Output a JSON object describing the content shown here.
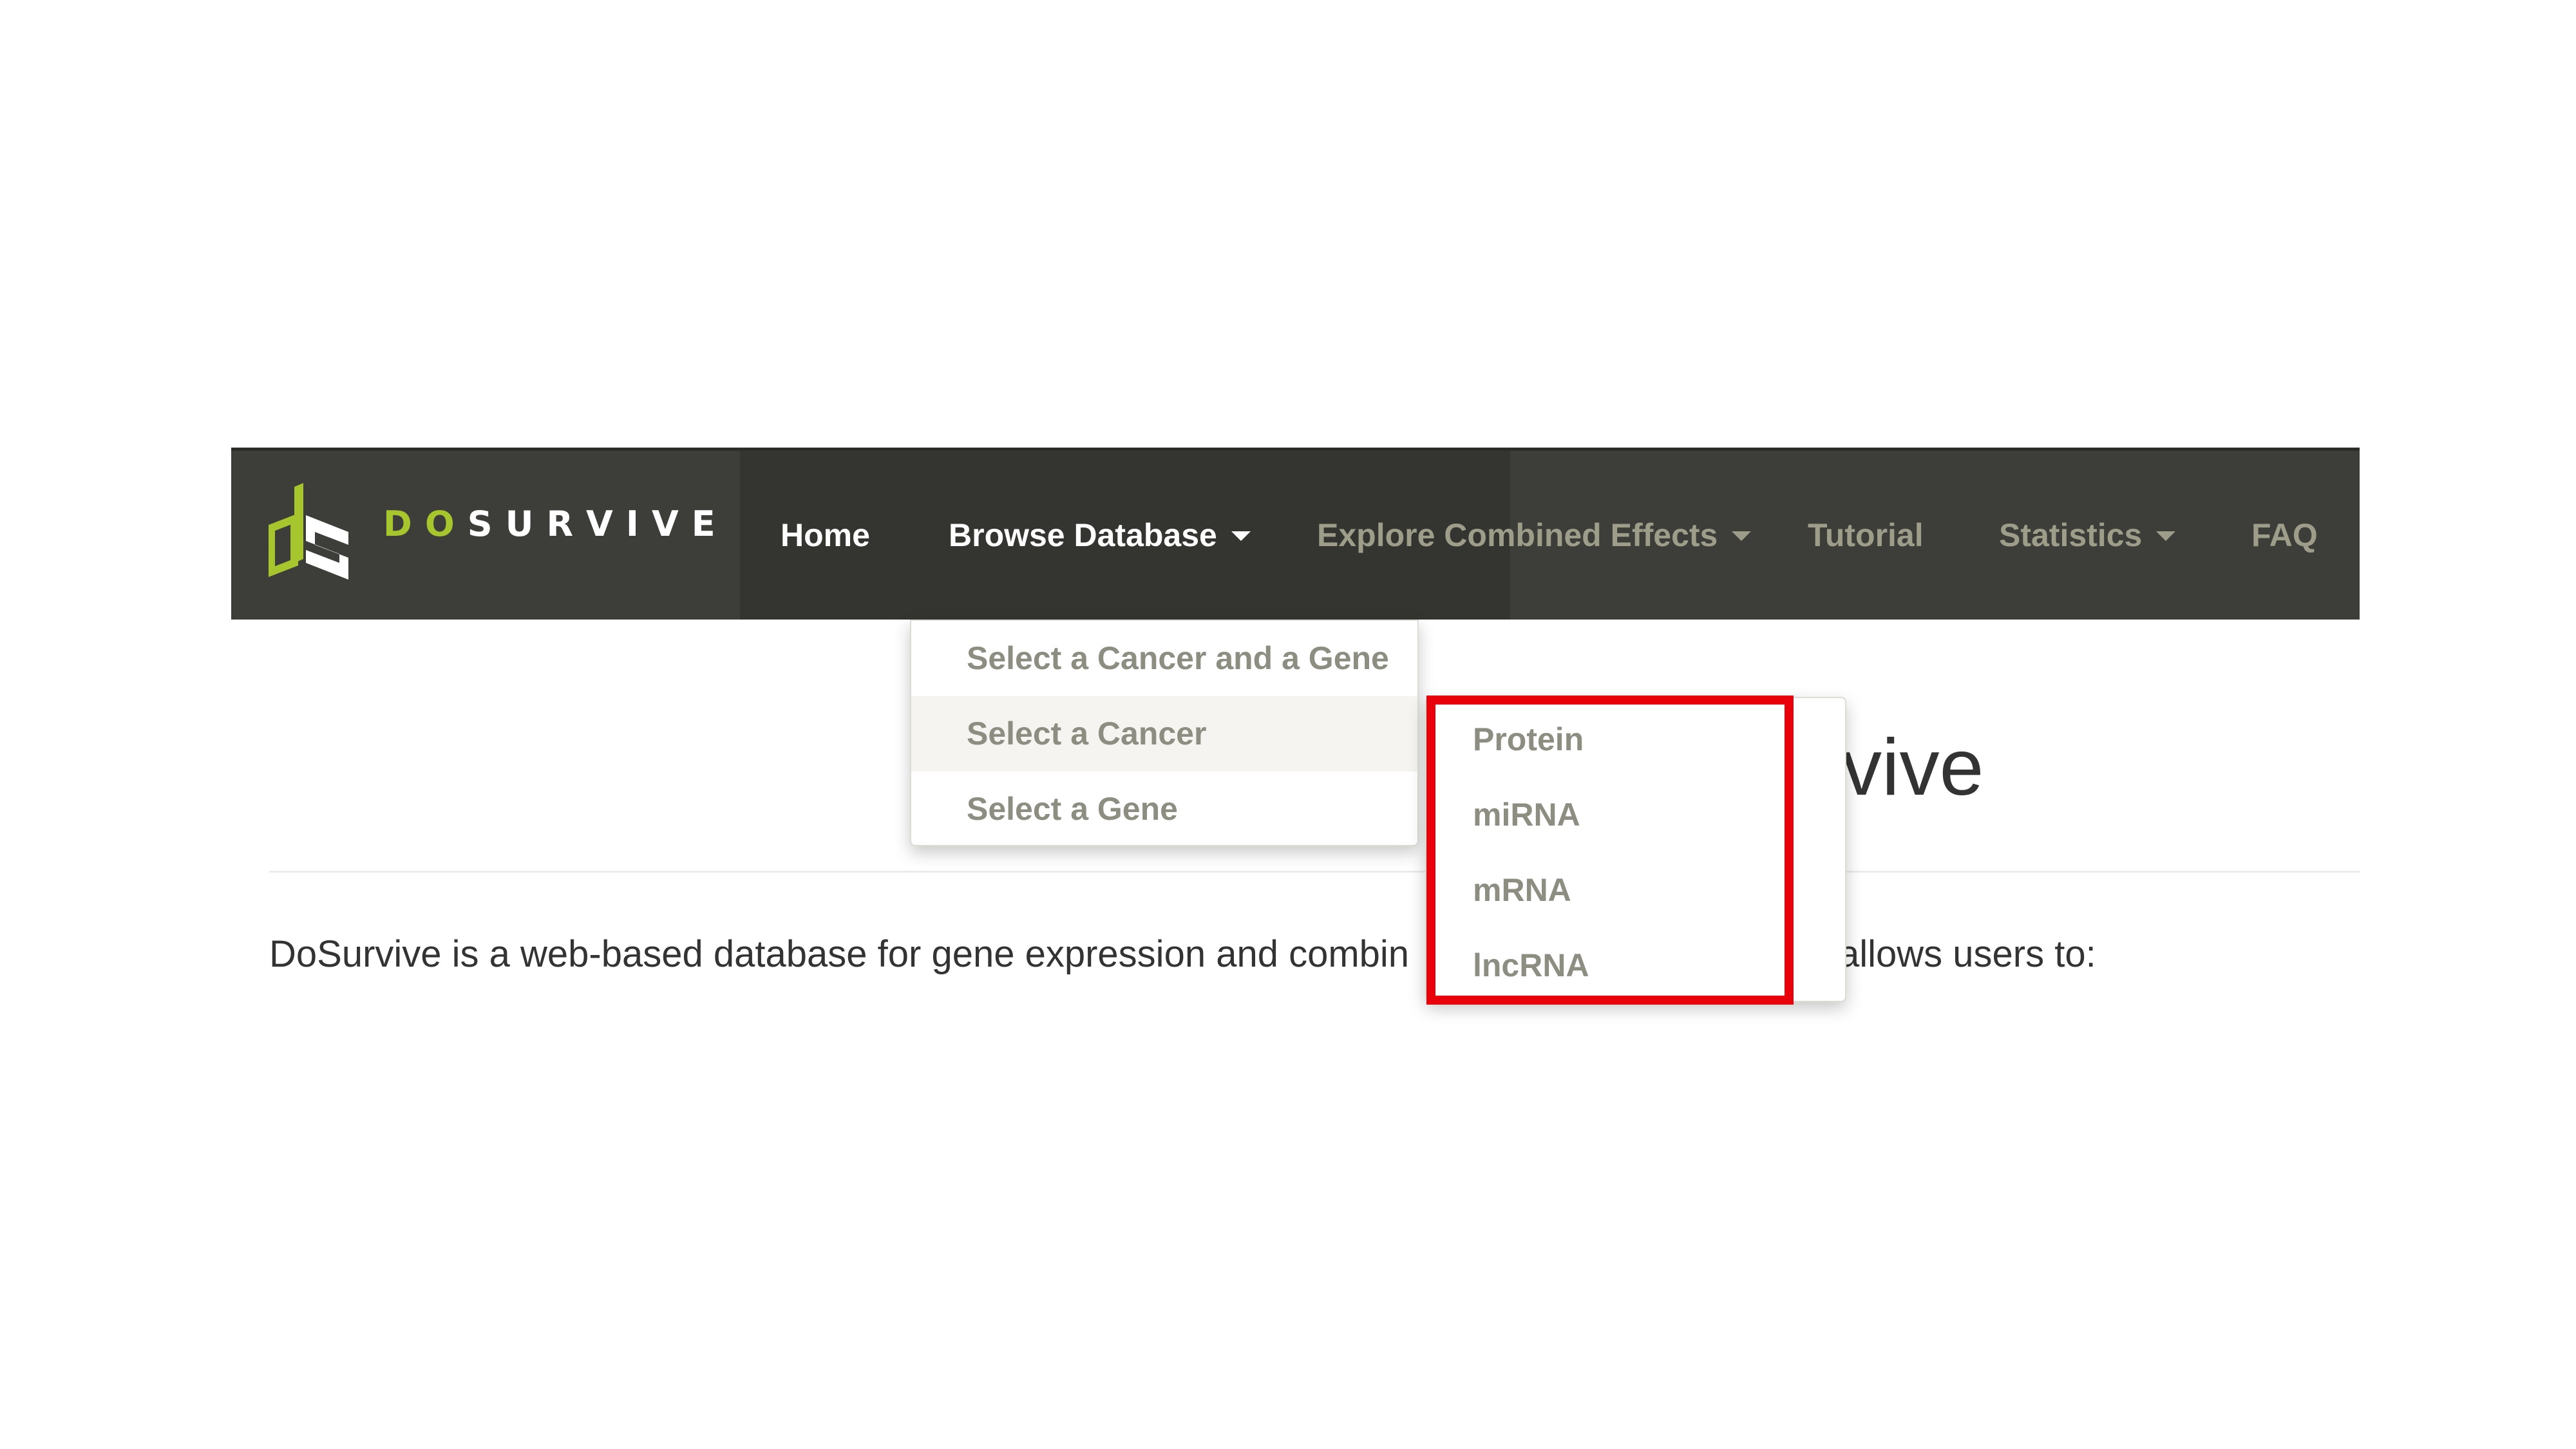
{
  "brand": {
    "prefix": "DO",
    "suffix": "SURVIVE",
    "logo_icon": "dosurvive-logo-icon",
    "colors": {
      "accent": "#a7c52c",
      "navbar_bg": "#3d3e39",
      "highlight": "#e8000b"
    }
  },
  "nav": {
    "home": "Home",
    "browse_database": "Browse Database",
    "explore_combined_effects": "Explore Combined Effects",
    "tutorial": "Tutorial",
    "statistics": "Statistics",
    "faq": "FAQ",
    "caret_icon": "caret-down-icon"
  },
  "browse_menu": {
    "items": [
      {
        "label": "Select a Cancer and a Gene"
      },
      {
        "label": "Select a Cancer"
      },
      {
        "label": "Select a Gene"
      }
    ]
  },
  "cancer_submenu": {
    "items": [
      {
        "label": "Protein"
      },
      {
        "label": "miRNA"
      },
      {
        "label": "mRNA"
      },
      {
        "label": "lncRNA"
      }
    ]
  },
  "main": {
    "heading_visible": "vive",
    "intro_left": "DoSurvive is a web-based database for gene expression and combin",
    "intro_right": "allows users to:"
  }
}
